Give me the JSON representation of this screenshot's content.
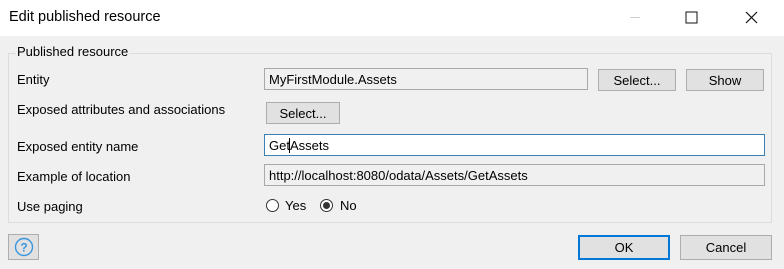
{
  "window": {
    "title": "Edit published resource",
    "controls": {
      "minimize": "minimize-icon",
      "maximize": "maximize-icon",
      "close": "close-icon"
    }
  },
  "group": {
    "title": "Published resource",
    "entity": {
      "label": "Entity",
      "value": "MyFirstModule.Assets",
      "select_label": "Select...",
      "show_label": "Show"
    },
    "attributes": {
      "label": "Exposed attributes and associations",
      "select_label": "Select..."
    },
    "entity_name": {
      "label": "Exposed entity name",
      "value": "GetAssets"
    },
    "location": {
      "label": "Example of location",
      "value": "http://localhost:8080/odata/Assets/GetAssets"
    },
    "paging": {
      "label": "Use paging",
      "options": [
        "Yes",
        "No"
      ],
      "selected": "No"
    }
  },
  "footer": {
    "help_icon": "help-icon",
    "ok_label": "OK",
    "cancel_label": "Cancel"
  },
  "colors": {
    "accent": "#0078d7",
    "input_focus": "#3c7fb1",
    "help_icon": "#3a96dd"
  }
}
